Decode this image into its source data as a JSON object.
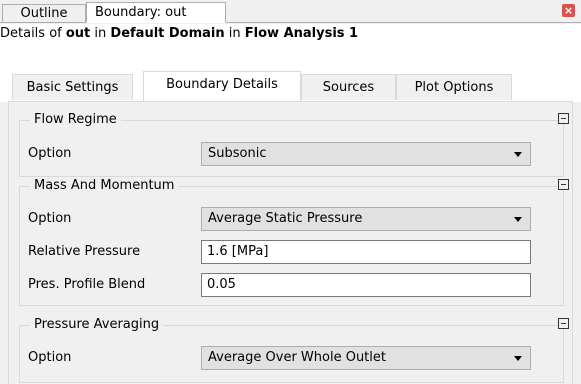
{
  "top_tabs": [
    {
      "label": "Outline"
    },
    {
      "label": "Boundary: out"
    }
  ],
  "details": {
    "prefix": "Details of ",
    "object": "out",
    "in1": " in ",
    "domain": "Default Domain",
    "in2": " in ",
    "analysis": "Flow Analysis 1"
  },
  "sub_tabs": [
    {
      "label": "Basic Settings"
    },
    {
      "label": "Boundary Details"
    },
    {
      "label": "Sources"
    },
    {
      "label": "Plot Options"
    }
  ],
  "groups": {
    "flow_regime": {
      "title": "Flow Regime",
      "option_label": "Option",
      "option_value": "Subsonic"
    },
    "mass_momentum": {
      "title": "Mass And Momentum",
      "option_label": "Option",
      "option_value": "Average Static Pressure",
      "rel_pressure_label": "Relative Pressure",
      "rel_pressure_value": "1.6 [MPa]",
      "profile_blend_label": "Pres. Profile Blend",
      "profile_blend_value": "0.05"
    },
    "pressure_averaging": {
      "title": "Pressure Averaging",
      "option_label": "Option",
      "option_value": "Average Over Whole Outlet"
    }
  },
  "colors": {
    "close_button": "#d9534f",
    "panel_bg": "#f0f0f0"
  }
}
